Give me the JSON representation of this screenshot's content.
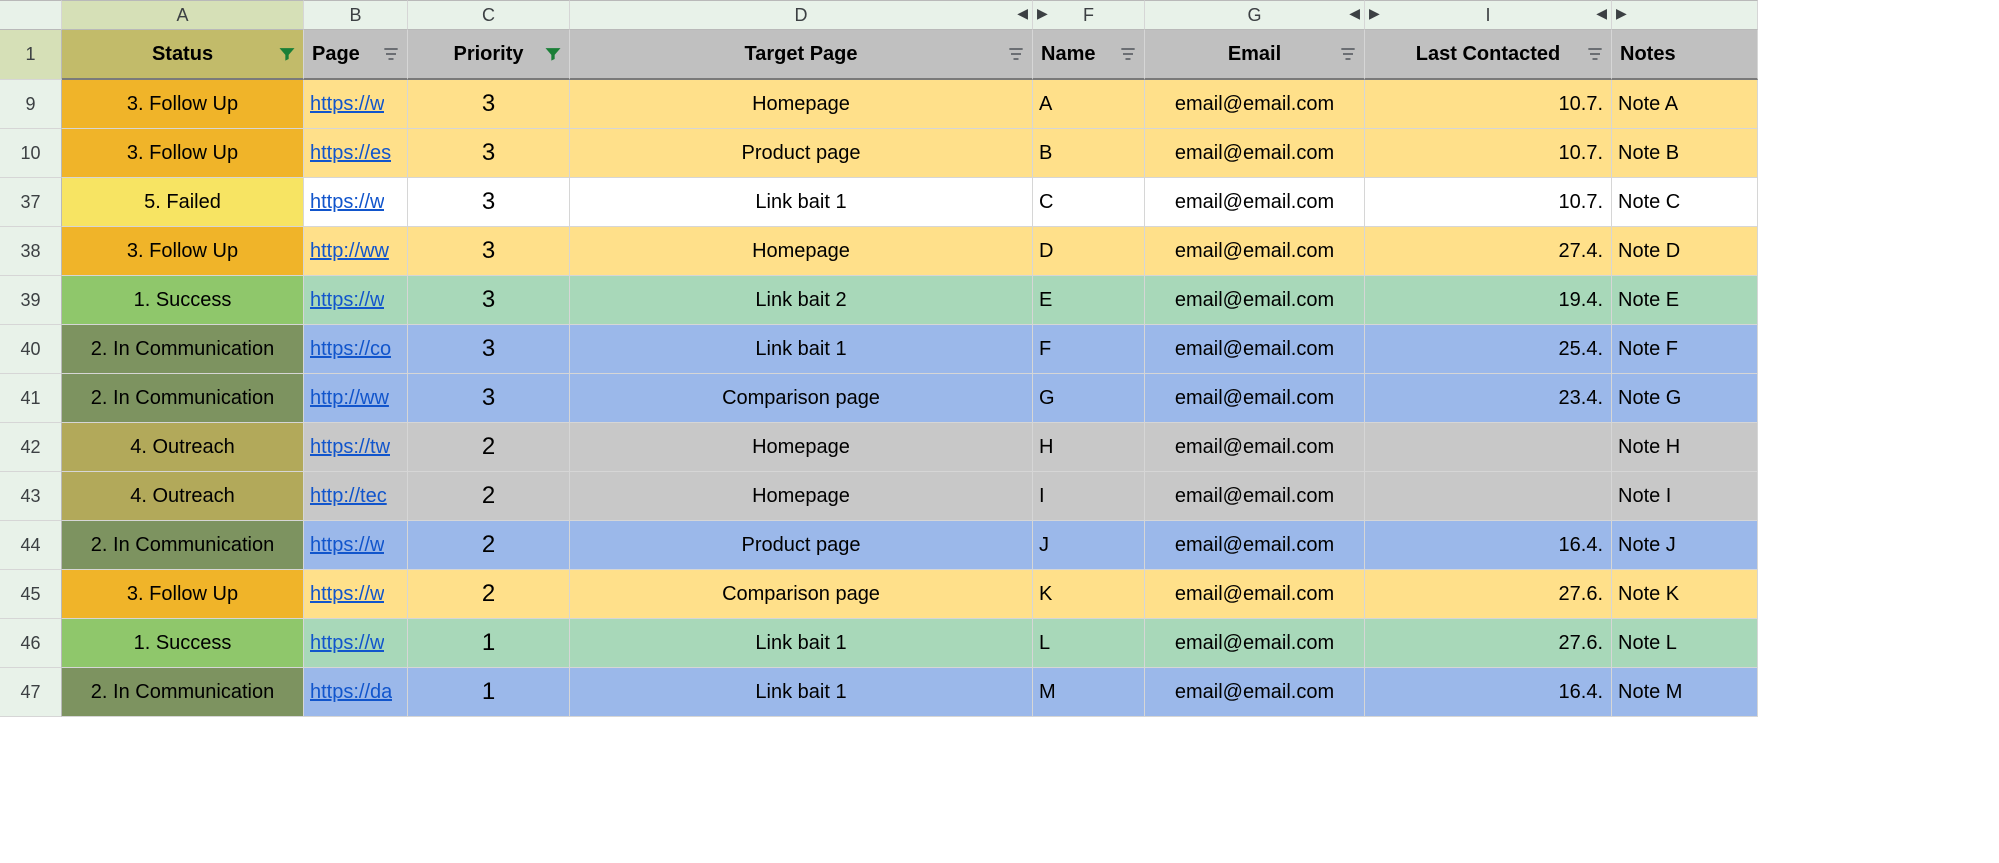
{
  "columns": {
    "A": "A",
    "B": "B",
    "C": "C",
    "D": "D",
    "F": "F",
    "G": "G",
    "I": "I",
    "notesCol": ""
  },
  "headers": {
    "status": "Status",
    "page": "Page",
    "priority": "Priority",
    "target": "Target Page",
    "name": "Name",
    "email": "Email",
    "last": "Last Contacted",
    "notes": "Notes"
  },
  "rows": [
    {
      "n": "9",
      "status": "3. Follow Up",
      "stClass": "st-followup",
      "bg": "bg-followup",
      "page": "https://w",
      "priority": "3",
      "target": "Homepage",
      "name": "A",
      "email": "email@email.com",
      "last": "10.7.",
      "notes": "Note A"
    },
    {
      "n": "10",
      "status": "3. Follow Up",
      "stClass": "st-followup",
      "bg": "bg-followup",
      "page": "https://es",
      "priority": "3",
      "target": "Product page",
      "name": "B",
      "email": "email@email.com",
      "last": "10.7.",
      "notes": "Note B"
    },
    {
      "n": "37",
      "status": "5. Failed",
      "stClass": "st-failed",
      "bg": "bg-failed",
      "page": "https://w",
      "priority": "3",
      "target": "Link bait 1",
      "name": "C",
      "email": "email@email.com",
      "last": "10.7.",
      "notes": "Note C"
    },
    {
      "n": "38",
      "status": "3. Follow Up",
      "stClass": "st-followup",
      "bg": "bg-followup",
      "page": "http://ww",
      "priority": "3",
      "target": "Homepage",
      "name": "D",
      "email": "email@email.com",
      "last": "27.4.",
      "notes": "Note D"
    },
    {
      "n": "39",
      "status": "1. Success",
      "stClass": "st-success",
      "bg": "bg-success",
      "page": "https://w",
      "priority": "3",
      "target": "Link bait 2",
      "name": "E",
      "email": "email@email.com",
      "last": "19.4.",
      "notes": "Note E"
    },
    {
      "n": "40",
      "status": "2. In Communication",
      "stClass": "st-comm",
      "bg": "bg-comm",
      "page": "https://co",
      "priority": "3",
      "target": "Link bait 1",
      "name": "F",
      "email": "email@email.com",
      "last": "25.4.",
      "notes": "Note F"
    },
    {
      "n": "41",
      "status": "2. In Communication",
      "stClass": "st-comm",
      "bg": "bg-comm",
      "page": "http://ww",
      "priority": "3",
      "target": "Comparison page",
      "name": "G",
      "email": "email@email.com",
      "last": "23.4.",
      "notes": "Note G"
    },
    {
      "n": "42",
      "status": "4. Outreach",
      "stClass": "st-outreach",
      "bg": "bg-outreach",
      "page": "https://tw",
      "priority": "2",
      "target": "Homepage",
      "name": "H",
      "email": "email@email.com",
      "last": "",
      "notes": "Note H"
    },
    {
      "n": "43",
      "status": "4. Outreach",
      "stClass": "st-outreach",
      "bg": "bg-outreach",
      "page": "http://tec",
      "priority": "2",
      "target": "Homepage",
      "name": "I",
      "email": "email@email.com",
      "last": "",
      "notes": "Note I"
    },
    {
      "n": "44",
      "status": "2. In Communication",
      "stClass": "st-comm",
      "bg": "bg-comm",
      "page": "https://w",
      "priority": "2",
      "target": "Product page",
      "name": "J",
      "email": "email@email.com",
      "last": "16.4.",
      "notes": "Note J"
    },
    {
      "n": "45",
      "status": "3. Follow Up",
      "stClass": "st-followup",
      "bg": "bg-followup",
      "page": "https://w",
      "priority": "2",
      "target": "Comparison page",
      "name": "K",
      "email": "email@email.com",
      "last": "27.6.",
      "notes": "Note K"
    },
    {
      "n": "46",
      "status": "1. Success",
      "stClass": "st-success",
      "bg": "bg-success",
      "page": "https://w",
      "priority": "1",
      "target": "Link bait 1",
      "name": "L",
      "email": "email@email.com",
      "last": "27.6.",
      "notes": "Note L"
    },
    {
      "n": "47",
      "status": "2. In Communication",
      "stClass": "st-comm",
      "bg": "bg-comm",
      "page": "https://da",
      "priority": "1",
      "target": "Link bait 1",
      "name": "M",
      "email": "email@email.com",
      "last": "16.4.",
      "notes": "Note M"
    }
  ]
}
